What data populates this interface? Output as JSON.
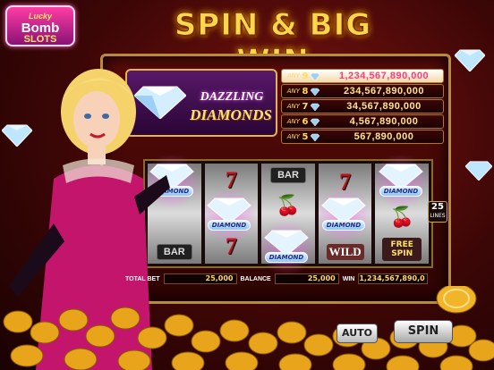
{
  "game": {
    "title": "SPIN & BIG WIN",
    "logo": {
      "line1": "Lucky",
      "line2": "Bomb",
      "line3": "SLOTS"
    },
    "machine_name": {
      "line1": "DAZZLING",
      "line2": "DIAMONDS"
    }
  },
  "jackpots": [
    {
      "prefix": "ANY",
      "count": "9",
      "value": "1,234,567,890,000"
    },
    {
      "prefix": "ANY",
      "count": "8",
      "value": "234,567,890,000"
    },
    {
      "prefix": "ANY",
      "count": "7",
      "value": "34,567,890,000"
    },
    {
      "prefix": "ANY",
      "count": "6",
      "value": "4,567,890,000"
    },
    {
      "prefix": "ANY",
      "count": "5",
      "value": "567,890,000"
    }
  ],
  "reels": {
    "symbol_labels": {
      "bar": "BAR",
      "seven": "7",
      "wild": "WILD",
      "free_spin": "FREE SPIN",
      "diamond": "DIAMOND",
      "cherry": "🍒"
    }
  },
  "lines": {
    "count": "25",
    "label": "LINES"
  },
  "info": {
    "total_bet_label": "TOTAL BET",
    "total_bet": "25,000",
    "balance_label": "BALANCE",
    "balance": "25,000",
    "win_label": "WIN",
    "win": "1,234,567,890,0"
  },
  "buttons": {
    "auto": "AUTO",
    "spin": "SPIN"
  },
  "colors": {
    "gold": "#ffd54a",
    "diamond_magenta": "#ff5cff",
    "cabinet_red": "#5a0b08"
  }
}
